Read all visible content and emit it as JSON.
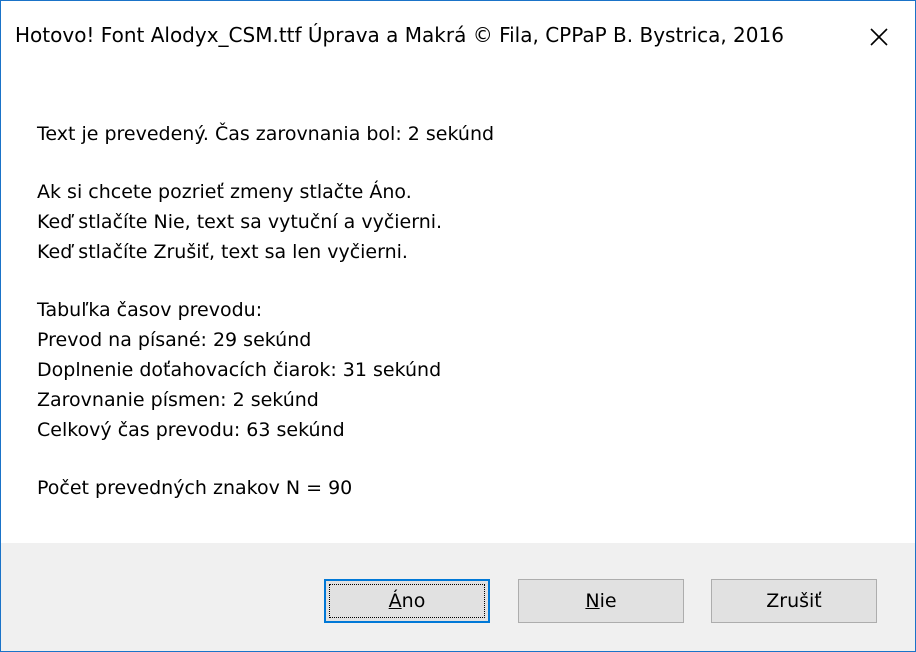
{
  "window": {
    "title": "Hotovo!   Font Alodyx_CSM.ttf Úprava a Makrá © Fila, CPPaP B. Bystrica, 2016"
  },
  "icons": {
    "close": "close-icon"
  },
  "message": {
    "result_line": "Text je prevedený. Čas zarovnania bol: 2 sekúnd",
    "instructions": [
      "Ak si chcete pozrieť zmeny stlačte Áno.",
      "Keď stlačíte Nie, text sa vytuční a vyčierni.",
      "Keď stlačíte Zrušiť, text sa len vyčierni."
    ],
    "table_title": "Tabuľka časov prevodu:",
    "times": [
      "Prevod na písané: 29 sekúnd",
      "Doplnenie doťahovacích čiarok: 31 sekúnd",
      "Zarovnanie písmen: 2 sekúnd",
      "Celkový čas prevodu: 63 sekúnd"
    ],
    "count_line": "Počet prevedných znakov N = 90"
  },
  "buttons": {
    "yes": {
      "mnemonic": "Á",
      "rest": "no"
    },
    "no": {
      "mnemonic": "N",
      "rest": "ie"
    },
    "cancel": {
      "label": "Zrušiť"
    }
  },
  "colors": {
    "accent": "#0078d7",
    "window_border": "#1a73c8",
    "footer_bg": "#f0f0f0",
    "button_bg": "#e1e1e1"
  }
}
